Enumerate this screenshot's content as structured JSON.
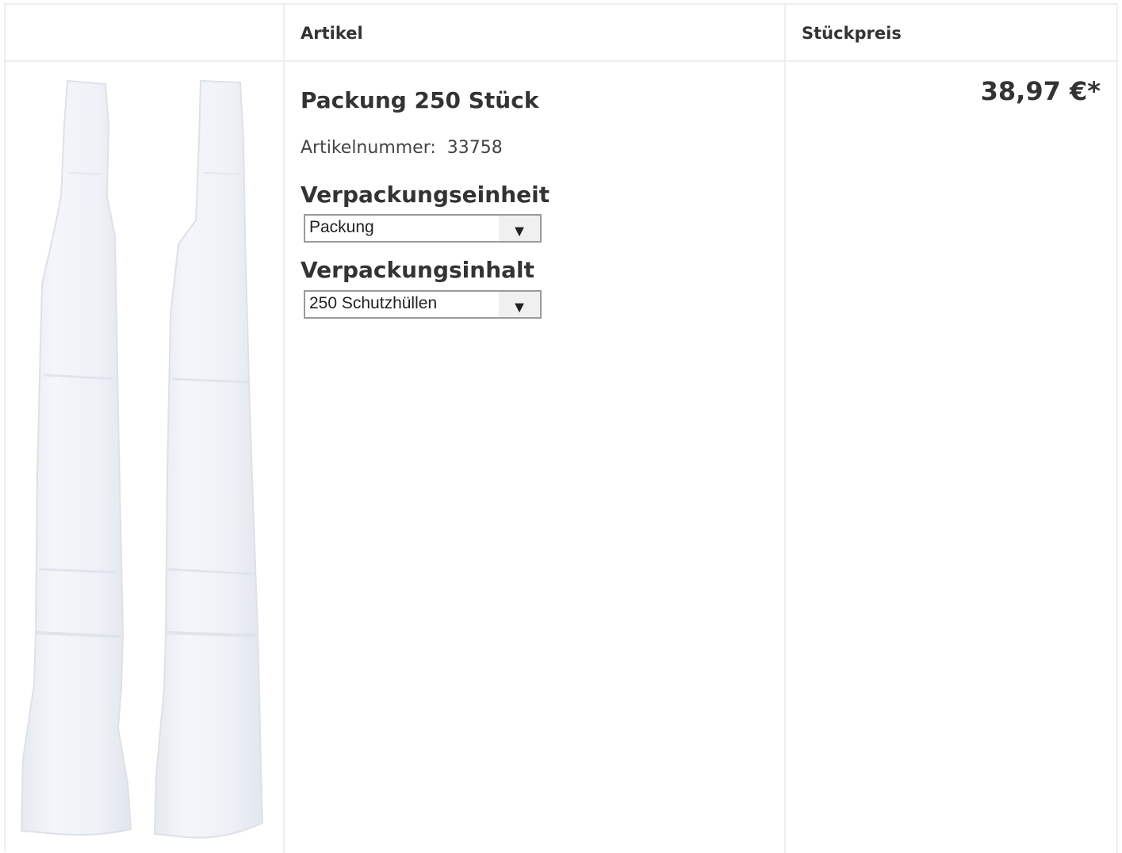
{
  "table": {
    "headers": {
      "image": "",
      "article": "Artikel",
      "unit_price": "Stückpreis"
    }
  },
  "product": {
    "title": "Packung 250 Stück",
    "article_number_label": "Artikelnummer:",
    "article_number": "33758",
    "packaging_unit": {
      "label": "Verpackungseinheit",
      "selected": "Packung"
    },
    "packaging_content": {
      "label": "Verpackungsinhalt",
      "selected": "250 Schutzhüllen"
    },
    "price": "38,97 €*",
    "image_icon": "product-image-transparent-sleeves"
  },
  "colors": {
    "border": "#eeeeee",
    "text": "#333333",
    "select_border": "#9a9a9a"
  }
}
